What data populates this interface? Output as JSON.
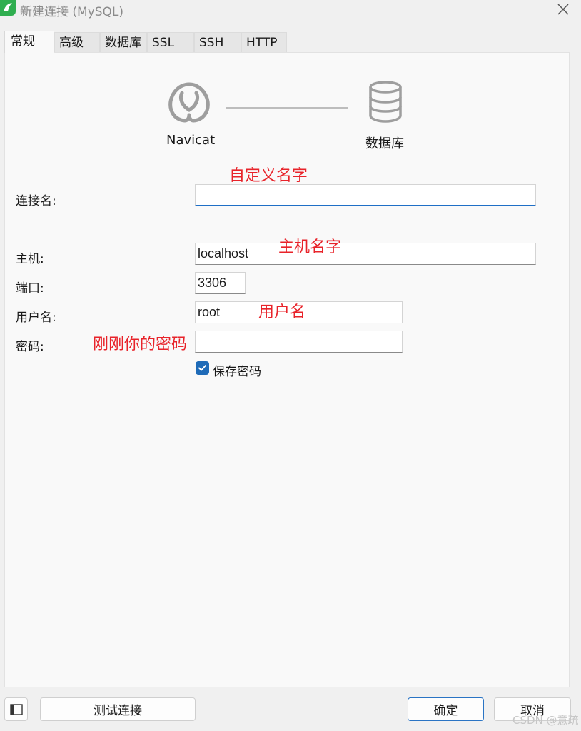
{
  "window": {
    "title": "新建连接 (MySQL)"
  },
  "tabs": [
    {
      "label": "常规",
      "active": true
    },
    {
      "label": "高级"
    },
    {
      "label": "数据库"
    },
    {
      "label": "SSL"
    },
    {
      "label": "SSH"
    },
    {
      "label": "HTTP"
    }
  ],
  "diagram": {
    "left_label": "Navicat",
    "right_label": "数据库"
  },
  "form": {
    "connection_name": {
      "label": "连接名:",
      "value": ""
    },
    "host": {
      "label": "主机:",
      "value": "localhost"
    },
    "port": {
      "label": "端口:",
      "value": "3306"
    },
    "username": {
      "label": "用户名:",
      "value": "root"
    },
    "password": {
      "label": "密码:",
      "value": ""
    },
    "save_password": {
      "label": "保存密码",
      "checked": true
    }
  },
  "annotations": {
    "connection_name_note": "自定义名字",
    "host_note": "主机名字",
    "username_note": "用户名",
    "password_note": "刚刚你的密码"
  },
  "footer": {
    "test_button": "测试连接",
    "ok_button": "确定",
    "cancel_button": "取消"
  },
  "watermark": "CSDN @意疏",
  "colors": {
    "accent": "#1f6fc6",
    "annotation": "#e8232a",
    "brand": "#2fae4f"
  }
}
